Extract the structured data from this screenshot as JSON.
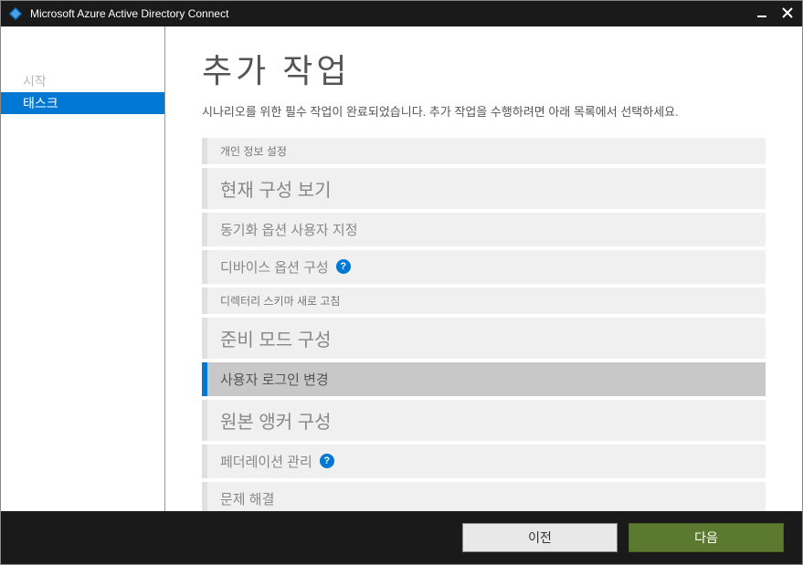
{
  "titlebar": {
    "title": "Microsoft Azure Active Directory Connect"
  },
  "sidebar": {
    "items": [
      {
        "label": "시작",
        "active": false
      },
      {
        "label": "태스크",
        "active": true
      }
    ]
  },
  "main": {
    "title": "추가 작업",
    "subtitle": "시나리오를 위한 필수 작업이 완료되었습니다. 추가 작업을 수행하려면 아래 목록에서 선택하세요."
  },
  "tasks": [
    {
      "label": "개인 정보 설정",
      "size": "small",
      "help": false,
      "selected": false
    },
    {
      "label": "현재 구성 보기",
      "size": "large",
      "help": false,
      "selected": false
    },
    {
      "label": "동기화 옵션 사용자 지정",
      "size": "normal",
      "help": false,
      "selected": false
    },
    {
      "label": "디바이스 옵션 구성",
      "size": "normal",
      "help": true,
      "selected": false
    },
    {
      "label": "디렉터리 스키마 새로 고침",
      "size": "small",
      "help": false,
      "selected": false
    },
    {
      "label": "준비 모드 구성",
      "size": "large",
      "help": false,
      "selected": false
    },
    {
      "label": "사용자 로그인 변경",
      "size": "normal",
      "help": false,
      "selected": true
    },
    {
      "label": "원본 앵커 구성",
      "size": "large",
      "help": false,
      "selected": false
    },
    {
      "label": "페더레이션 관리",
      "size": "normal",
      "help": true,
      "selected": false
    },
    {
      "label": "문제 해결",
      "size": "normal",
      "help": false,
      "selected": false
    }
  ],
  "footer": {
    "prev": "이전",
    "next": "다음"
  }
}
